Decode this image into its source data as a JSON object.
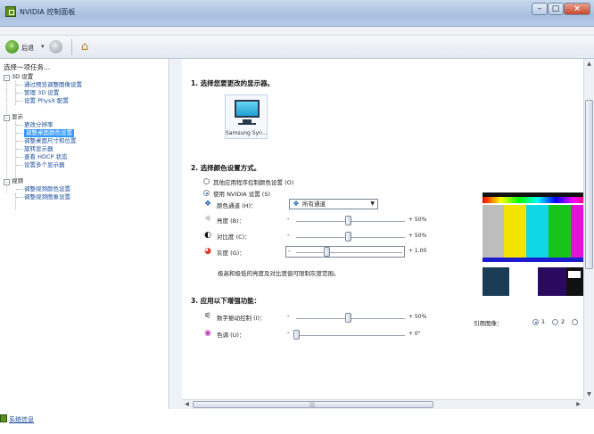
{
  "window": {
    "title": "NVIDIA 控制面板",
    "minimize": "–",
    "maximize": "□",
    "close": "×"
  },
  "toolbar": {
    "back_label": "后退",
    "dropdown": "▾",
    "back_icon": "‹",
    "forward_icon": "›",
    "home_icon": "⌂"
  },
  "left": {
    "heading": "选择一项任务...",
    "tree": [
      {
        "type": "cat",
        "label": "3D 设置",
        "box": "-"
      },
      {
        "type": "link",
        "label": "通过预览调整图像设置"
      },
      {
        "type": "link",
        "label": "管理 3D 设置"
      },
      {
        "type": "link",
        "label": "设置 PhysX 配置"
      },
      {
        "type": "cat",
        "label": "显示",
        "box": "-"
      },
      {
        "type": "link",
        "label": "更改分辨率"
      },
      {
        "type": "sel",
        "label": "调整桌面颜色设置"
      },
      {
        "type": "link",
        "label": "调整桌面尺寸和位置"
      },
      {
        "type": "link",
        "label": "旋转显示器"
      },
      {
        "type": "link",
        "label": "查看 HDCP 状态"
      },
      {
        "type": "link",
        "label": "设置多个显示器"
      },
      {
        "type": "cat",
        "label": "视频",
        "box": "-"
      },
      {
        "type": "link",
        "label": "调整视频颜色设置"
      },
      {
        "type": "link",
        "label": "调整视频图象设置"
      }
    ],
    "system_info": "系统信息"
  },
  "main": {
    "section1": "1. 选择您要更改的显示器。",
    "monitor_label": "Samsung Syn...",
    "section2": "2. 选择颜色设置方式。",
    "radio_other": "其他应用程序控制颜色设置 (O)",
    "radio_nvidia": "使用 NVIDIA 设置 (S)",
    "channel_label": "颜色通道 (H)：",
    "channel_value": "所有通道",
    "brightness_label": "亮度 (B)：",
    "brightness_value": "+ 50%",
    "brightness_level": 0.5,
    "contrast_label": "对比度 (C)：",
    "contrast_value": "+ 50%",
    "contrast_level": 0.5,
    "gamma_label": "灰度 (G)：",
    "gamma_value": "+ 1.00",
    "gamma_level": 0.3,
    "gamma_note": "极高和极低的亮度及对比度值可限制灰度范围。",
    "section3": "3. 应用以下增强功能：",
    "vibrance_label": "数字振动控制 (I)：",
    "vibrance_value": "+ 50%",
    "vibrance_level": 0.5,
    "hue_label": "色调 (U)：",
    "hue_value": "+ 0°",
    "hue_level": 0.0,
    "minus": "-",
    "ref_label": "引用图像：",
    "ref_options": [
      "1",
      "2"
    ],
    "scroll_up": "▲",
    "scroll_down": "▼",
    "scroll_left": "◀",
    "scroll_right": "▶",
    "scroll_grip": "|||"
  },
  "colors": {
    "bars": [
      "#bdbdbd",
      "#f2e300",
      "#10d6e6",
      "#17c51a",
      "#e014d8"
    ],
    "top_gradient": [
      "#ff0000",
      "#ffff00",
      "#00ff00",
      "#00ffff",
      "#0000ff",
      "#ff00ff",
      "#ff0000"
    ]
  }
}
